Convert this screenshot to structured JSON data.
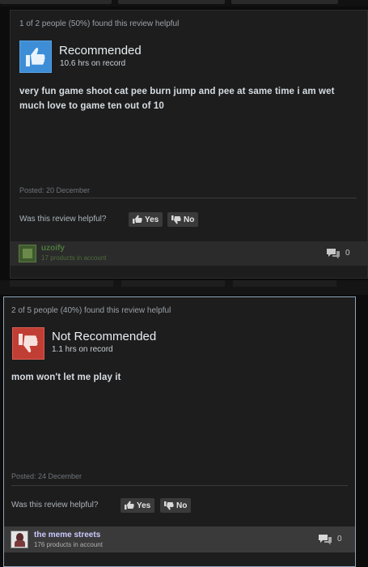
{
  "review1": {
    "helpful_count": "1 of 2 people (50%) found this review helpful",
    "verdict": "Recommended",
    "verdict_icon": "thumbs-up-icon",
    "hours": "10.6 hrs on record",
    "body": "very fun game shoot cat pee burn jump and pee at same time i am wet much love to game ten out of 10",
    "posted": "Posted: 20 December",
    "helpful_question": "Was this review helpful?",
    "yes_label": "Yes",
    "no_label": "No",
    "author": "uzoify",
    "author_products": "17 products in account",
    "comments": "0"
  },
  "review2": {
    "helpful_count": "2 of 5 people (40%) found this review helpful",
    "verdict": "Not Recommended",
    "verdict_icon": "thumbs-down-icon",
    "hours": "1.1 hrs on record",
    "body": "mom won't let me play it",
    "posted": "Posted: 24 December",
    "helpful_question": "Was this review helpful?",
    "yes_label": "Yes",
    "no_label": "No",
    "author": "the meme streets",
    "author_products": "176 products in account",
    "comments": "0"
  },
  "colors": {
    "recommended": "#3e8ed7",
    "not_recommended": "#c13e34",
    "active_border": "#8ea4b8",
    "author_name_1": "#4f7a3c",
    "author_name_2": "#c9c9ff"
  }
}
